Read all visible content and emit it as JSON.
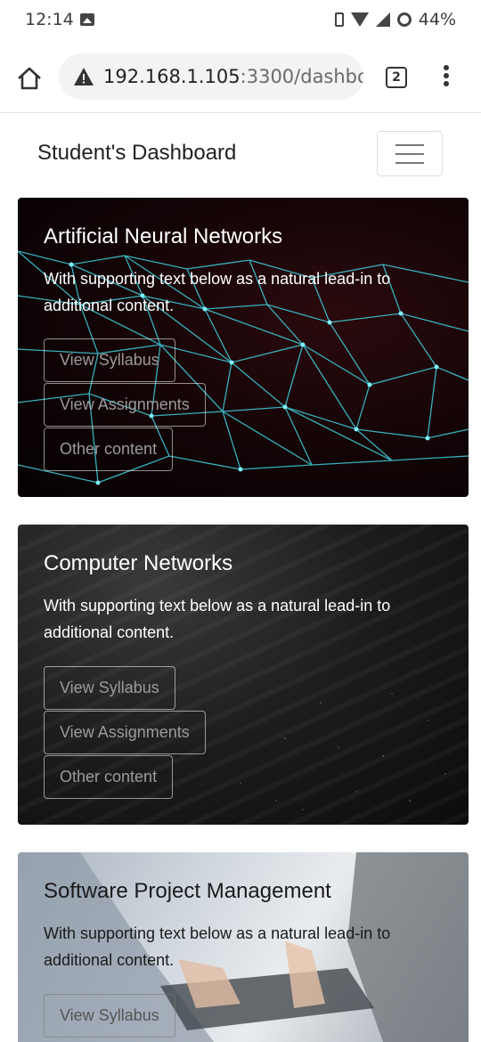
{
  "status_bar": {
    "time": "12:14",
    "battery": "44%",
    "icons": [
      "image-icon",
      "vibrate-icon",
      "wifi-icon",
      "signal-icon",
      "battery-saver-icon"
    ]
  },
  "browser": {
    "url_host": "192.168.1.105",
    "url_path": ":3300/dashbo",
    "tab_count": "2",
    "icons": [
      "home-icon",
      "warning-icon",
      "tab-switcher-icon",
      "more-vert-icon"
    ]
  },
  "navbar": {
    "brand": "Student's Dashboard",
    "toggler_icon": "hamburger-icon"
  },
  "cards": [
    {
      "title": "Artificial Neural Networks",
      "text": "With supporting text below as a natural lead-in to additional content.",
      "buttons": [
        "View Syllabus",
        "View Assignments",
        "Other content"
      ]
    },
    {
      "title": "Computer Networks",
      "text": "With supporting text below as a natural lead-in to additional content.",
      "buttons": [
        "View Syllabus",
        "View Assignments",
        "Other content"
      ]
    },
    {
      "title": "Software Project Management",
      "text": "With supporting text below as a natural lead-in to additional content.",
      "buttons": [
        "View Syllabus"
      ]
    }
  ],
  "colors": {
    "card_text": "#ffffff",
    "network_lines": "#3fd0e0",
    "button_text": "#9a9a9a"
  }
}
